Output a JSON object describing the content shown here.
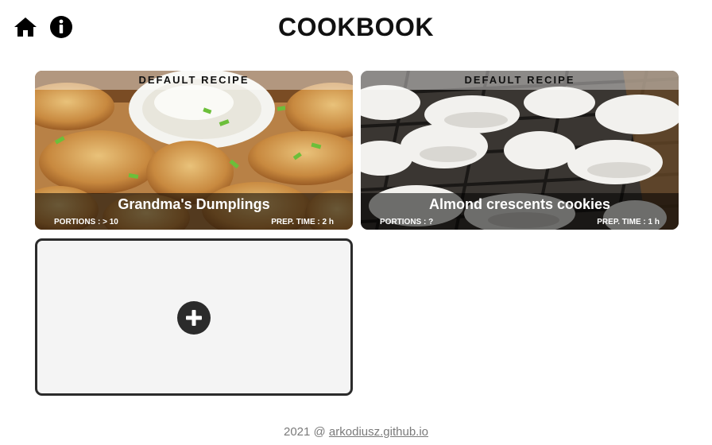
{
  "header": {
    "title": "COOKBOOK",
    "home_icon": "home-icon",
    "info_icon": "info-icon"
  },
  "recipes": [
    {
      "badge": "DEFAULT RECIPE",
      "name": "Grandma's Dumplings",
      "portions": "PORTIONS : > 10",
      "prep_time": "PREP. TIME : 2 h"
    },
    {
      "badge": "DEFAULT RECIPE",
      "name": "Almond crescents cookies",
      "portions": "PORTIONS : ?",
      "prep_time": "PREP. TIME : 1 h"
    }
  ],
  "add_card": {
    "icon": "plus-icon"
  },
  "footer": {
    "prefix": "2021 @",
    "link_text": "arkodiusz.github.io"
  },
  "colors": {
    "text": "#111111",
    "add_card_bg": "#f4f4f4",
    "add_card_border": "#2b2b2b",
    "footer_text": "#7a7a7a"
  }
}
